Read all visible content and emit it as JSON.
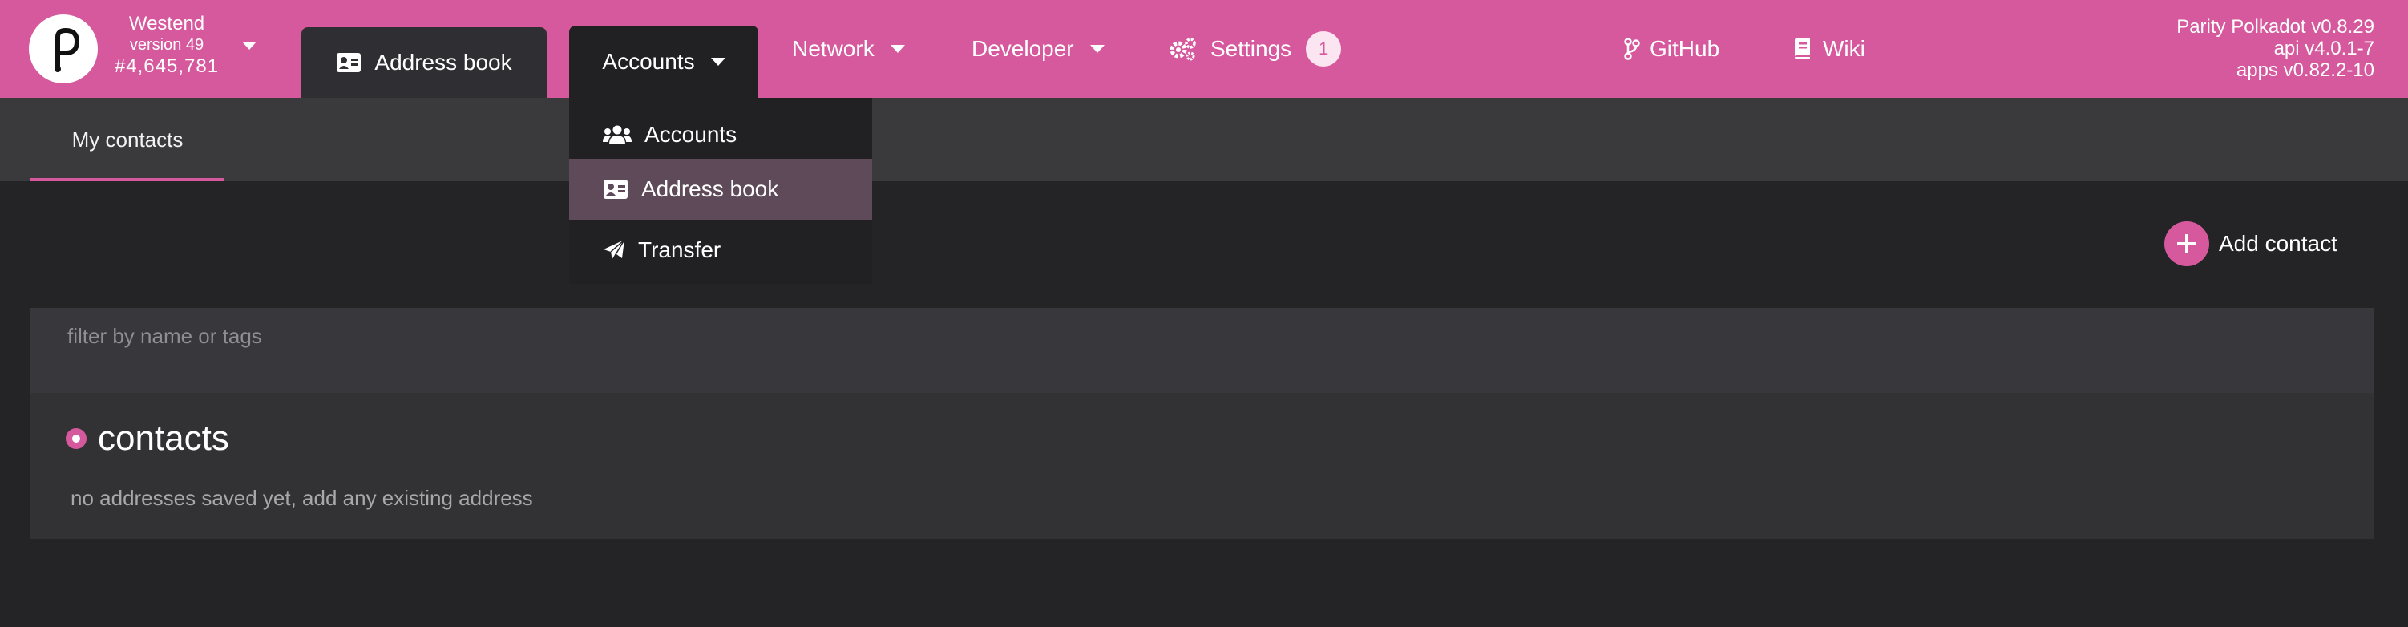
{
  "brand": {
    "chain_name": "Westend",
    "chain_version": "version 49",
    "block_number": "#4,645,781",
    "logo_icon": "polkadot-logo-icon"
  },
  "nav": {
    "address_book": "Address book",
    "accounts": "Accounts",
    "network": "Network",
    "developer": "Developer",
    "settings": "Settings",
    "settings_badge": "1",
    "github": "GitHub",
    "wiki": "Wiki"
  },
  "versions": {
    "node": "Parity Polkadot v0.8.29",
    "api": "api v4.0.1-7",
    "apps": "apps v0.82.2-10"
  },
  "dropdown": {
    "items": [
      {
        "label": "Accounts",
        "icon": "users-icon"
      },
      {
        "label": "Address book",
        "icon": "address-card-icon"
      },
      {
        "label": "Transfer",
        "icon": "paper-plane-icon"
      }
    ]
  },
  "subnav": {
    "tab": "My contacts"
  },
  "actions": {
    "add_contact": "Add contact"
  },
  "filter": {
    "placeholder": "filter by name or tags"
  },
  "contacts": {
    "title": "contacts",
    "empty": "no addresses saved yet, add any existing address"
  },
  "colors": {
    "accent": "#d6599e",
    "background": "#242427",
    "menu_highlight": "#5e4a58"
  }
}
